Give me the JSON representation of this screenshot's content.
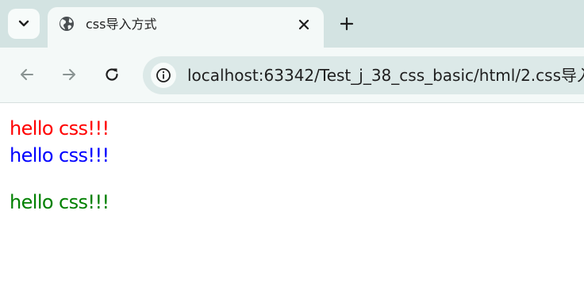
{
  "browser": {
    "tab": {
      "title": "css导入方式",
      "favicon": "globe-icon"
    },
    "address_bar": {
      "host": "localhost",
      "path": ":63342/Test_j_38_css_basic/html/2.css导入"
    }
  },
  "page": {
    "lines": [
      {
        "text": "hello css!!!",
        "color": "#ff0000"
      },
      {
        "text": "hello css!!!",
        "color": "#0000ff"
      },
      {
        "text": "hello css!!!",
        "color": "#008000"
      }
    ]
  }
}
